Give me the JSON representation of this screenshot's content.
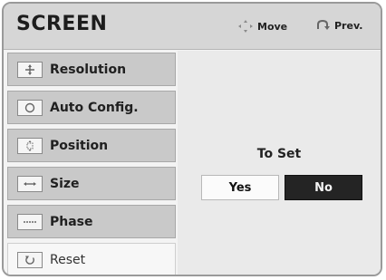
{
  "header": {
    "title": "SCREEN",
    "move_label": "Move",
    "prev_label": "Prev."
  },
  "menu": {
    "items": [
      {
        "label": "Resolution",
        "icon": "resolution-icon"
      },
      {
        "label": "Auto Config.",
        "icon": "auto-config-icon"
      },
      {
        "label": "Position",
        "icon": "position-icon"
      },
      {
        "label": "Size",
        "icon": "size-icon"
      },
      {
        "label": "Phase",
        "icon": "phase-icon"
      },
      {
        "label": "Reset",
        "icon": "reset-icon"
      }
    ]
  },
  "panel": {
    "prompt": "To Set",
    "yes_label": "Yes",
    "no_label": "No"
  }
}
